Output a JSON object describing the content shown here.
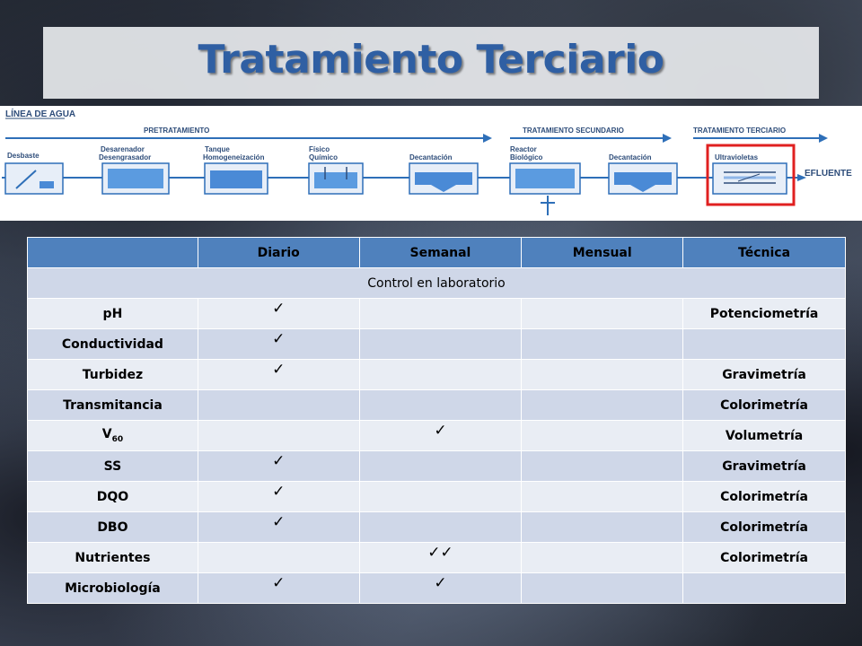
{
  "title": "Tratamiento Terciario",
  "process": {
    "line_label": "LÍNEA DE AGUA",
    "stages": [
      "PRETRATAMIENTO",
      "TRATAMIENTO SECUNDARIO",
      "TRATAMIENTO TERCIARIO"
    ],
    "units": [
      {
        "label1": "Desbaste",
        "label2": ""
      },
      {
        "label1": "Desarenador",
        "label2": "Desengrasador"
      },
      {
        "label1": "Tanque",
        "label2": "Homogeneización"
      },
      {
        "label1": "Físico",
        "label2": "Químico"
      },
      {
        "label1": "Decantación",
        "label2": ""
      },
      {
        "label1": "Reactor",
        "label2": "Biológico"
      },
      {
        "label1": "Decantación",
        "label2": ""
      },
      {
        "label1": "Ultravioletas",
        "label2": ""
      }
    ],
    "outlet": "EFLUENTE",
    "highlight_color": "#e02020"
  },
  "table": {
    "headers": [
      "",
      "Diario",
      "Semanal",
      "Mensual",
      "Técnica"
    ],
    "section_label": "Control en laboratorio",
    "rows": [
      {
        "param": "pH",
        "diario": "✓",
        "semanal": "",
        "mensual": "",
        "tecnica": "Potenciometría"
      },
      {
        "param": "Conductividad",
        "diario": "✓",
        "semanal": "",
        "mensual": "",
        "tecnica": ""
      },
      {
        "param": "Turbidez",
        "diario": "✓",
        "semanal": "",
        "mensual": "",
        "tecnica": "Gravimetría"
      },
      {
        "param": "Transmitancia",
        "diario": "",
        "semanal": "",
        "mensual": "",
        "tecnica": "Colorimetría"
      },
      {
        "param": "V",
        "param_sub": "60",
        "diario": "",
        "semanal": "✓",
        "mensual": "",
        "tecnica": "Volumetría"
      },
      {
        "param": "SS",
        "diario": "✓",
        "semanal": "",
        "mensual": "",
        "tecnica": "Gravimetría"
      },
      {
        "param": "DQO",
        "diario": "✓",
        "semanal": "",
        "mensual": "",
        "tecnica": "Colorimetría"
      },
      {
        "param": "DBO",
        "diario": "✓",
        "semanal": "",
        "mensual": "",
        "tecnica": "Colorimetría"
      },
      {
        "param": "Nutrientes",
        "diario": "",
        "semanal": "✓✓",
        "mensual": "",
        "tecnica": "Colorimetría"
      },
      {
        "param": "Microbiología",
        "diario": "✓",
        "semanal": "✓",
        "mensual": "",
        "tecnica": ""
      }
    ]
  }
}
